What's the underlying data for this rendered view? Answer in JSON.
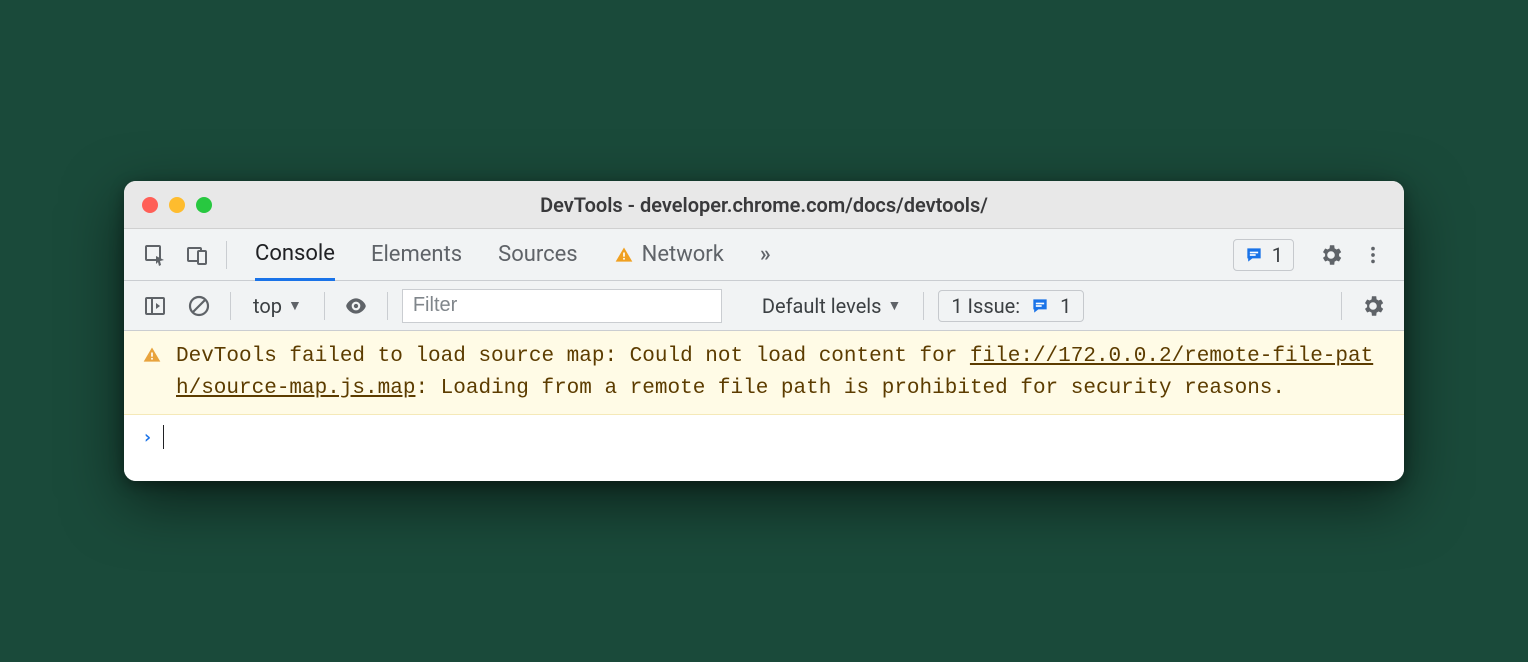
{
  "window": {
    "title": "DevTools - developer.chrome.com/docs/devtools/"
  },
  "toolbar": {
    "tabs": [
      "Console",
      "Elements",
      "Sources",
      "Network"
    ],
    "active_tab_index": 0,
    "overflow_label": "»",
    "issue_count": "1"
  },
  "subbar": {
    "context_label": "top",
    "filter_placeholder": "Filter",
    "levels_label": "Default levels",
    "issue_label": "1 Issue:",
    "issue_count": "1"
  },
  "console": {
    "warning_prefix": "DevTools failed to load source map: Could not load content for ",
    "warning_link": "file://172.0.0.2/remote-file-path/source-map.js.map",
    "warning_suffix": ": Loading from a remote file path is prohibited for security reasons.",
    "prompt": ">"
  }
}
